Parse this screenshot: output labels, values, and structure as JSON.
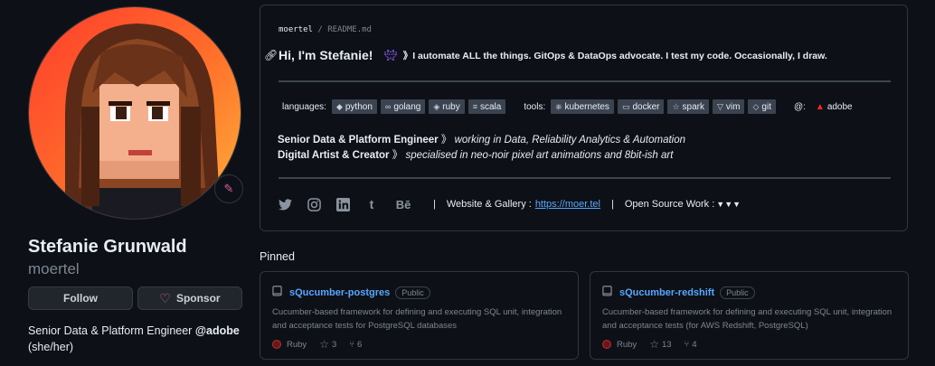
{
  "profile": {
    "fullname": "Stefanie Grunwald",
    "login": "moertel",
    "follow_label": "Follow",
    "sponsor_label": "Sponsor",
    "bio_prefix": "Senior Data & Platform Engineer ",
    "bio_org": "@adobe",
    "pronouns": "(she/her)",
    "status_icon": "pen-icon"
  },
  "readme": {
    "owner": "moertel",
    "separator": "/",
    "file": "README.md",
    "greeting": "Hi, I'm Stefanie!",
    "tagline": "》I automate ALL the things. GitOps & DataOps advocate. I test my code. Occasionally, I draw.",
    "languages_label": "languages:",
    "languages": [
      "python",
      "golang",
      "ruby",
      "scala"
    ],
    "tools_label": "tools:",
    "tools": [
      "kubernetes",
      "docker",
      "spark",
      "vim",
      "git"
    ],
    "at_label": "@:",
    "company": "adobe",
    "role1_title": "Senior Data & Platform Engineer",
    "role1_sep": " 》",
    "role1_desc": "working in Data, Reliability Analytics & Automation",
    "role2_title": "Digital Artist & Creator",
    "role2_sep": " 》",
    "role2_desc": "specialised in neo-noir pixel art animations and 8bit-ish art",
    "social_icons": [
      "twitter-icon",
      "instagram-icon",
      "linkedin-icon",
      "tumblr-icon",
      "behance-icon"
    ],
    "behance_text": "Bē",
    "pipe": "|",
    "website_label": "Website & Gallery :",
    "website_link": "https://moer.tel",
    "oss_label": "Open Source Work :",
    "oss_arrows": "▼▼▼"
  },
  "pinned": {
    "title": "Pinned",
    "repos": [
      {
        "name": "sQucumber-postgres",
        "visibility": "Public",
        "description": "Cucumber-based framework for defining and executing SQL unit, integration and acceptance tests for PostgreSQL databases",
        "language": "Ruby",
        "stars": "3",
        "forks": "6"
      },
      {
        "name": "sQucumber-redshift",
        "visibility": "Public",
        "description": "Cucumber-based framework for defining and executing SQL unit, integration and acceptance tests (for AWS Redshift, PostgreSQL)",
        "language": "Ruby",
        "stars": "13",
        "forks": "4"
      }
    ]
  },
  "colors": {
    "background": "#0d1117",
    "link": "#58a6ff",
    "border": "#30363d",
    "ruby": "#701516",
    "sponsor_heart": "#db61a2"
  }
}
